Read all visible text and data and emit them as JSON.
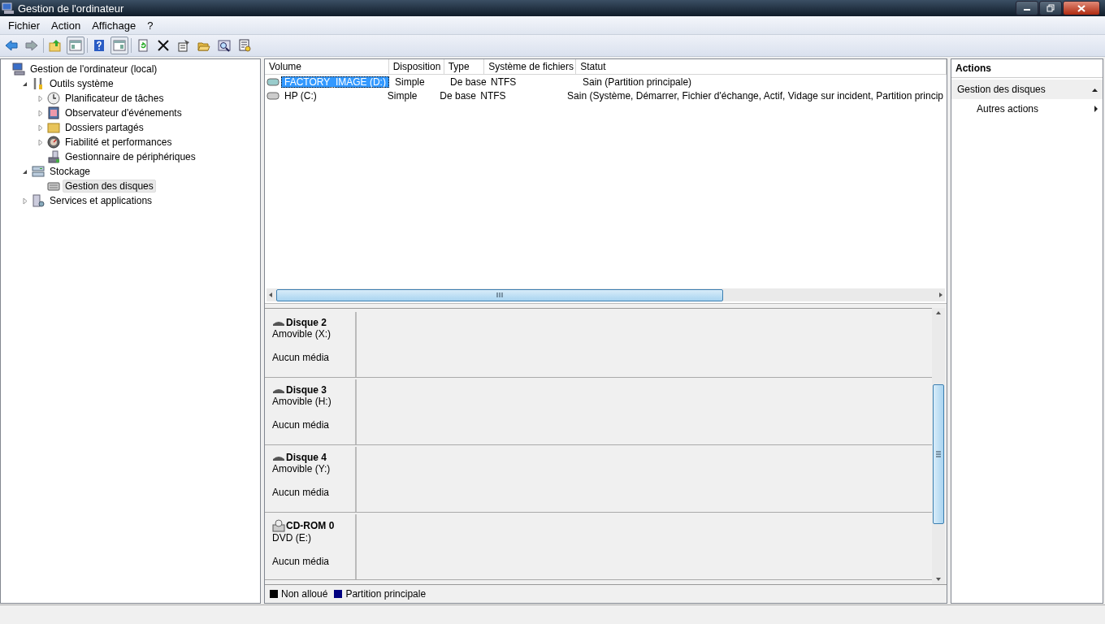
{
  "window": {
    "title": "Gestion de l'ordinateur"
  },
  "menu": [
    "Fichier",
    "Action",
    "Affichage",
    "?"
  ],
  "toolbar": [
    {
      "kind": "back",
      "pressed": false
    },
    {
      "kind": "forward",
      "pressed": false
    },
    {
      "kind": "sep"
    },
    {
      "kind": "up-folder",
      "pressed": false
    },
    {
      "kind": "pane-left",
      "pressed": true
    },
    {
      "kind": "sep"
    },
    {
      "kind": "help",
      "pressed": false
    },
    {
      "kind": "pane-right",
      "pressed": true
    },
    {
      "kind": "sep"
    },
    {
      "kind": "refresh",
      "pressed": false
    },
    {
      "kind": "delete",
      "pressed": false
    },
    {
      "kind": "properties",
      "pressed": false
    },
    {
      "kind": "open-folder",
      "pressed": false
    },
    {
      "kind": "find",
      "pressed": false
    },
    {
      "kind": "settings",
      "pressed": false
    }
  ],
  "tree": [
    {
      "label": "Gestion de l'ordinateur (local)",
      "kind": "computer",
      "selected": false,
      "children": [
        {
          "label": "Outils système",
          "kind": "tools",
          "expanded": true,
          "selected": false,
          "children": [
            {
              "label": "Planificateur de tâches",
              "kind": "clock",
              "expanded": false,
              "selected": false
            },
            {
              "label": "Observateur d'événements",
              "kind": "log",
              "expanded": false,
              "selected": false
            },
            {
              "label": "Dossiers partagés",
              "kind": "folder",
              "expanded": false,
              "selected": false
            },
            {
              "label": "Fiabilité et performances",
              "kind": "gauge",
              "expanded": false,
              "selected": false
            },
            {
              "label": "Gestionnaire de périphériques",
              "kind": "devices",
              "selected": false
            }
          ]
        },
        {
          "label": "Stockage",
          "kind": "storage",
          "expanded": true,
          "selected": false,
          "children": [
            {
              "label": "Gestion des disques",
              "kind": "disk",
              "selected": true
            }
          ]
        },
        {
          "label": "Services et applications",
          "kind": "services",
          "expanded": false,
          "selected": false
        }
      ]
    }
  ],
  "table": {
    "columns": [
      "Volume",
      "Disposition",
      "Type",
      "Système de fichiers",
      "Statut"
    ],
    "rows": [
      {
        "cells": [
          "FACTORY_IMAGE (D:)",
          "Simple",
          "De base",
          "NTFS",
          "Sain (Partition principale)"
        ],
        "selected": true
      },
      {
        "cells": [
          "HP (C:)",
          "Simple",
          "De base",
          "NTFS",
          "Sain (Système, Démarrer, Fichier d'échange, Actif, Vidage sur incident, Partition princip"
        ],
        "selected": false
      }
    ]
  },
  "disks": [
    {
      "name": "Disque 2",
      "kind": "removable",
      "type": "Amovible (X:)",
      "status": "Aucun média"
    },
    {
      "name": "Disque 3",
      "kind": "removable",
      "type": "Amovible (H:)",
      "status": "Aucun média"
    },
    {
      "name": "Disque 4",
      "kind": "removable",
      "type": "Amovible (Y:)",
      "status": "Aucun média"
    },
    {
      "name": "CD-ROM 0",
      "kind": "cdrom",
      "type": "DVD (E:)",
      "status": "Aucun média"
    }
  ],
  "legend": [
    {
      "label": "Non alloué",
      "color": "#000000"
    },
    {
      "label": "Partition principale",
      "color": "#000080"
    }
  ],
  "actions": {
    "title": "Actions",
    "group": "Gestion des disques",
    "items": [
      "Autres actions"
    ]
  }
}
